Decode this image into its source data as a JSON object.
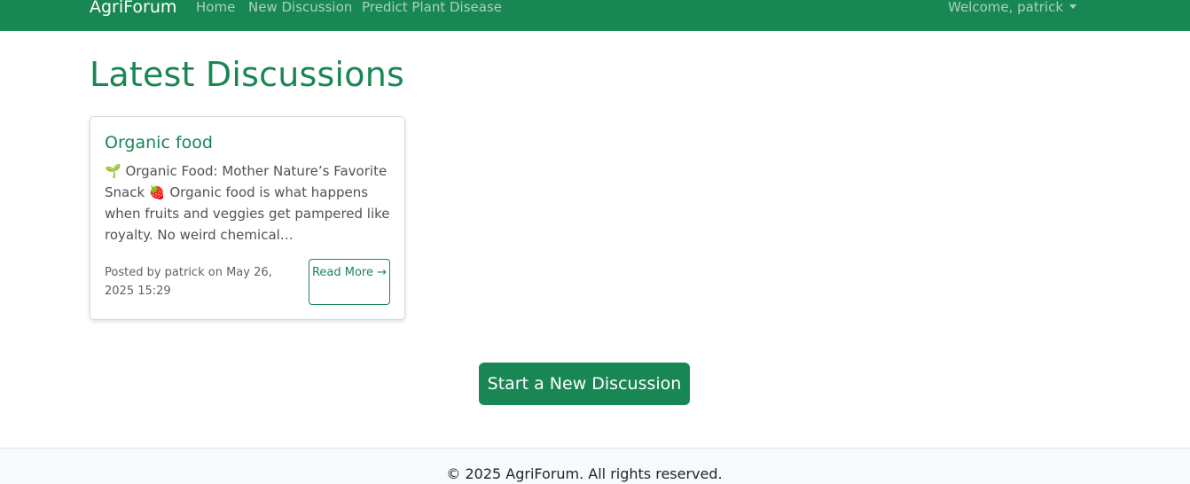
{
  "navbar": {
    "brand": "AgriForum",
    "links": [
      "Home",
      "New Discussion",
      "Predict Plant Disease"
    ],
    "user_menu": "Welcome, patrick",
    "color": "#198754"
  },
  "main": {
    "title": "Latest Discussions",
    "posts": [
      {
        "title": "Organic food",
        "excerpt": "🌱 Organic Food: Mother Nature’s Favorite Snack 🍓 Organic food is what happens when fruits and veggies get pampered like royalty. No weird chemical…",
        "meta": "Posted by patrick on May 26, 2025 15:29",
        "read_more": "Read More →"
      }
    ],
    "start_button": "Start a New Discussion"
  },
  "footer": {
    "text": "© 2025 AgriForum. All rights reserved."
  }
}
